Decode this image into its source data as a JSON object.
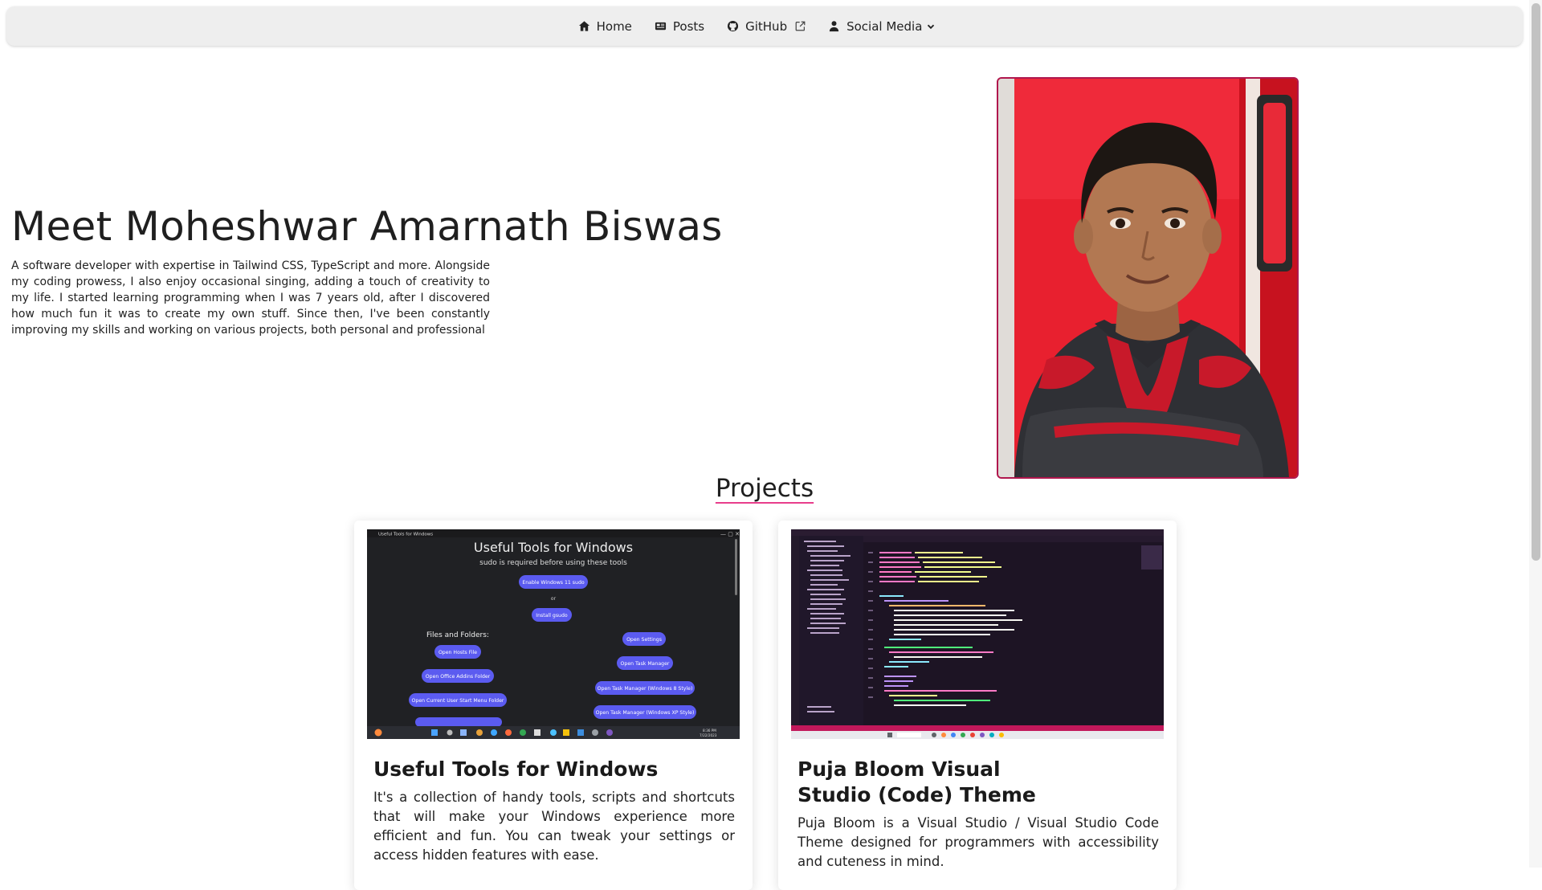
{
  "nav": {
    "home": "Home",
    "posts": "Posts",
    "github": "GitHub",
    "social": "Social Media"
  },
  "hero": {
    "title": "Meet Moheshwar Amarnath Biswas",
    "description": "A software developer with expertise in Tailwind CSS, TypeScript and more. Alongside my coding prowess, I also enjoy occasional singing, adding a touch of creativity to my life. I started learning programming when I was 7 years old, after I discovered how much fun it was to create my own stuff. Since then, I've been constantly improving my skills and working on various projects, both personal and professional"
  },
  "projects": {
    "heading": "Projects",
    "items": [
      {
        "title": "Useful Tools for Windows",
        "description": "It's a collection of handy tools, scripts and shortcuts that will make your Windows experience more efficient and fun. You can tweak your settings or access hidden features with ease.",
        "screenshot": {
          "window_title": "Useful Tools for Windows",
          "heading": "Useful Tools for Windows",
          "subheading": "sudo is required before using these tools",
          "primary_button": "Enable Windows 11 sudo",
          "or_text": "or",
          "secondary_button": "Install gsudo",
          "section_label": "Files and Folders:",
          "left_buttons": [
            "Open Hosts File",
            "Open Office Addins Folder",
            "Open Current User Start Menu Folder"
          ],
          "right_buttons": [
            "Open Settings",
            "Open Task Manager",
            "Open Task Manager (Windows 8 Style)",
            "Open Task Manager (Windows XP Style)"
          ],
          "clock_time": "8:36 PM",
          "clock_date": "7/22/2023"
        }
      },
      {
        "title": "Puja Bloom Visual Studio (Code) Theme",
        "description": "Puja Bloom is a Visual Studio / Visual Studio Code Theme designed for programmers with accessibility and cuteness in mind."
      }
    ]
  },
  "colors": {
    "accent": "#e83e8c",
    "portrait_border": "#b0174d",
    "navbar_bg": "#eeeeee",
    "tool_button": "#5b5bf0"
  }
}
